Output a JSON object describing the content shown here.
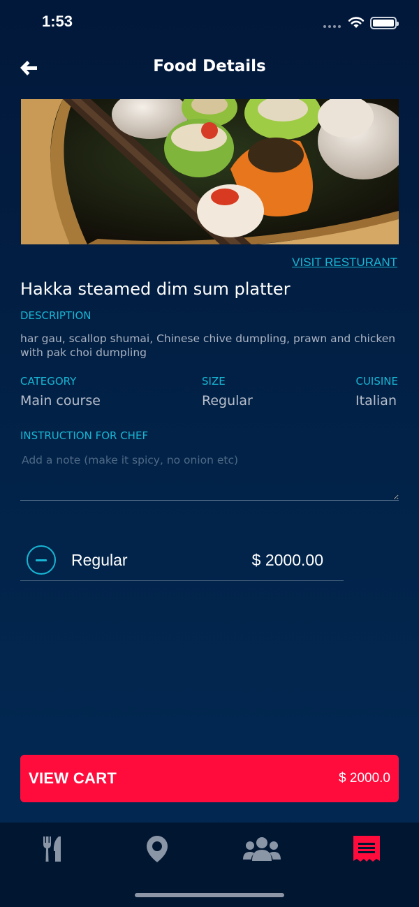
{
  "status_bar": {
    "time": "1:53"
  },
  "header": {
    "title": "Food Details"
  },
  "visit_link": "VISIT RESTURANT",
  "food": {
    "name": "Hakka steamed dim sum platter",
    "description_label": "DESCRIPTION",
    "description": "har gau, scallop shumai, Chinese chive dumpling, prawn and chicken with pak choi dumpling",
    "category_label": "CATEGORY",
    "category": "Main course",
    "size_label": "SIZE",
    "size": "Regular",
    "cuisine_label": "CUISINE",
    "cuisine": "Italian"
  },
  "instruction": {
    "label": "INSTRUCTION FOR CHEF",
    "placeholder": "Add a note (make it spicy, no onion etc)",
    "value": ""
  },
  "selected_size": {
    "name": "Regular",
    "price": "$ 2000.00"
  },
  "cart": {
    "label": "VIEW CART",
    "total": "$ 2000.0"
  },
  "tabs": [
    {
      "icon": "utensils-icon",
      "active": false
    },
    {
      "icon": "location-pin-icon",
      "active": false
    },
    {
      "icon": "users-icon",
      "active": false
    },
    {
      "icon": "receipt-icon",
      "active": true
    }
  ],
  "colors": {
    "background": "#022349",
    "accent": "#18b6d4",
    "primary_button": "#ff0c3d",
    "inactive_icon": "#8a95a6"
  }
}
